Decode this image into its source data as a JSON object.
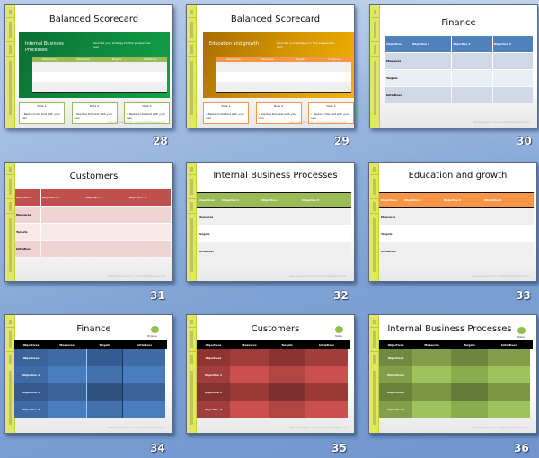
{
  "view": "Slide Sorter",
  "colors": {
    "green_accent": "#9bbb59",
    "orange_accent": "#f79646",
    "blue_accent": "#4f81bd",
    "red_accent": "#c0504d",
    "side_tab_yellow": "#e4ec5c",
    "status_dot": "#92c04a"
  },
  "common": {
    "side_tabs": [
      "Exit",
      "Implement",
      "Design",
      "Balanced Scorecard Training"
    ],
    "footer": "www.bsidesigner.com | support@bsidesigner.com"
  },
  "slides": [
    {
      "number": "28",
      "title": "Balanced Scorecard",
      "panel_title": "Internal Business Processes",
      "panel_desc": "Describe your strategy for this perspective here",
      "columns": [
        "Objectives",
        "Measures",
        "Targets",
        "Initiatives"
      ],
      "notes": [
        {
          "head": "Note 1",
          "body": "• Replace this text with your own"
        },
        {
          "head": "Note 2",
          "body": "• Replace this text with your own"
        },
        {
          "head": "Note 3",
          "body": "• Replace this text with your own"
        }
      ]
    },
    {
      "number": "29",
      "title": "Balanced Scorecard",
      "panel_title": "Education and growth",
      "panel_desc": "Describe your strategy for this perspective here",
      "columns": [
        "Objectives",
        "Measures",
        "Targets",
        "Initiatives"
      ],
      "notes": [
        {
          "head": "Note 1",
          "body": "• Replace this text with your own"
        },
        {
          "head": "Note 2",
          "body": "• Replace this text with your own"
        },
        {
          "head": "Note 3",
          "body": "• Replace this text with your own"
        }
      ]
    },
    {
      "number": "30",
      "title": "Finance",
      "columns": [
        "Objectives",
        "Objective 1",
        "Objective 2",
        "Objective 3"
      ],
      "rows": [
        "Measures",
        "Targets",
        "Initiatives"
      ]
    },
    {
      "number": "31",
      "title": "Customers",
      "columns": [
        "Objectives",
        "Objective 1",
        "Objective 2",
        "Objective 3"
      ],
      "rows": [
        "Measures",
        "Targets",
        "Initiatives"
      ]
    },
    {
      "number": "32",
      "title": "Internal Business Processes",
      "columns": [
        "Objectives",
        "Objective 1",
        "Objective 2",
        "Objective 3"
      ],
      "rows": [
        "Measures",
        "Targets",
        "Initiatives"
      ]
    },
    {
      "number": "33",
      "title": "Education and growth",
      "columns": [
        "Objectives",
        "Objective 1",
        "Objective 2",
        "Objective 3"
      ],
      "rows": [
        "Measures",
        "Targets",
        "Initiatives"
      ]
    },
    {
      "number": "34",
      "title": "Finance",
      "status_label": "Progress",
      "columns": [
        "Objectives",
        "Measures",
        "Targets",
        "Initiatives"
      ],
      "rows": [
        "Objectives",
        "Objective 1",
        "Objective 2",
        "Objective 3"
      ]
    },
    {
      "number": "35",
      "title": "Customers",
      "status_label": "Status",
      "columns": [
        "Objectives",
        "Measures",
        "Targets",
        "Initiatives"
      ],
      "rows": [
        "Objectives",
        "Objective 1",
        "Objective 2",
        "Objective 3"
      ]
    },
    {
      "number": "36",
      "title": "Internal Business Processes",
      "status_label": "Status",
      "columns": [
        "Objectives",
        "Measures",
        "Targets",
        "Initiatives"
      ],
      "rows": [
        "Objectives",
        "Objective 1",
        "Objective 2",
        "Objective 3"
      ]
    }
  ]
}
